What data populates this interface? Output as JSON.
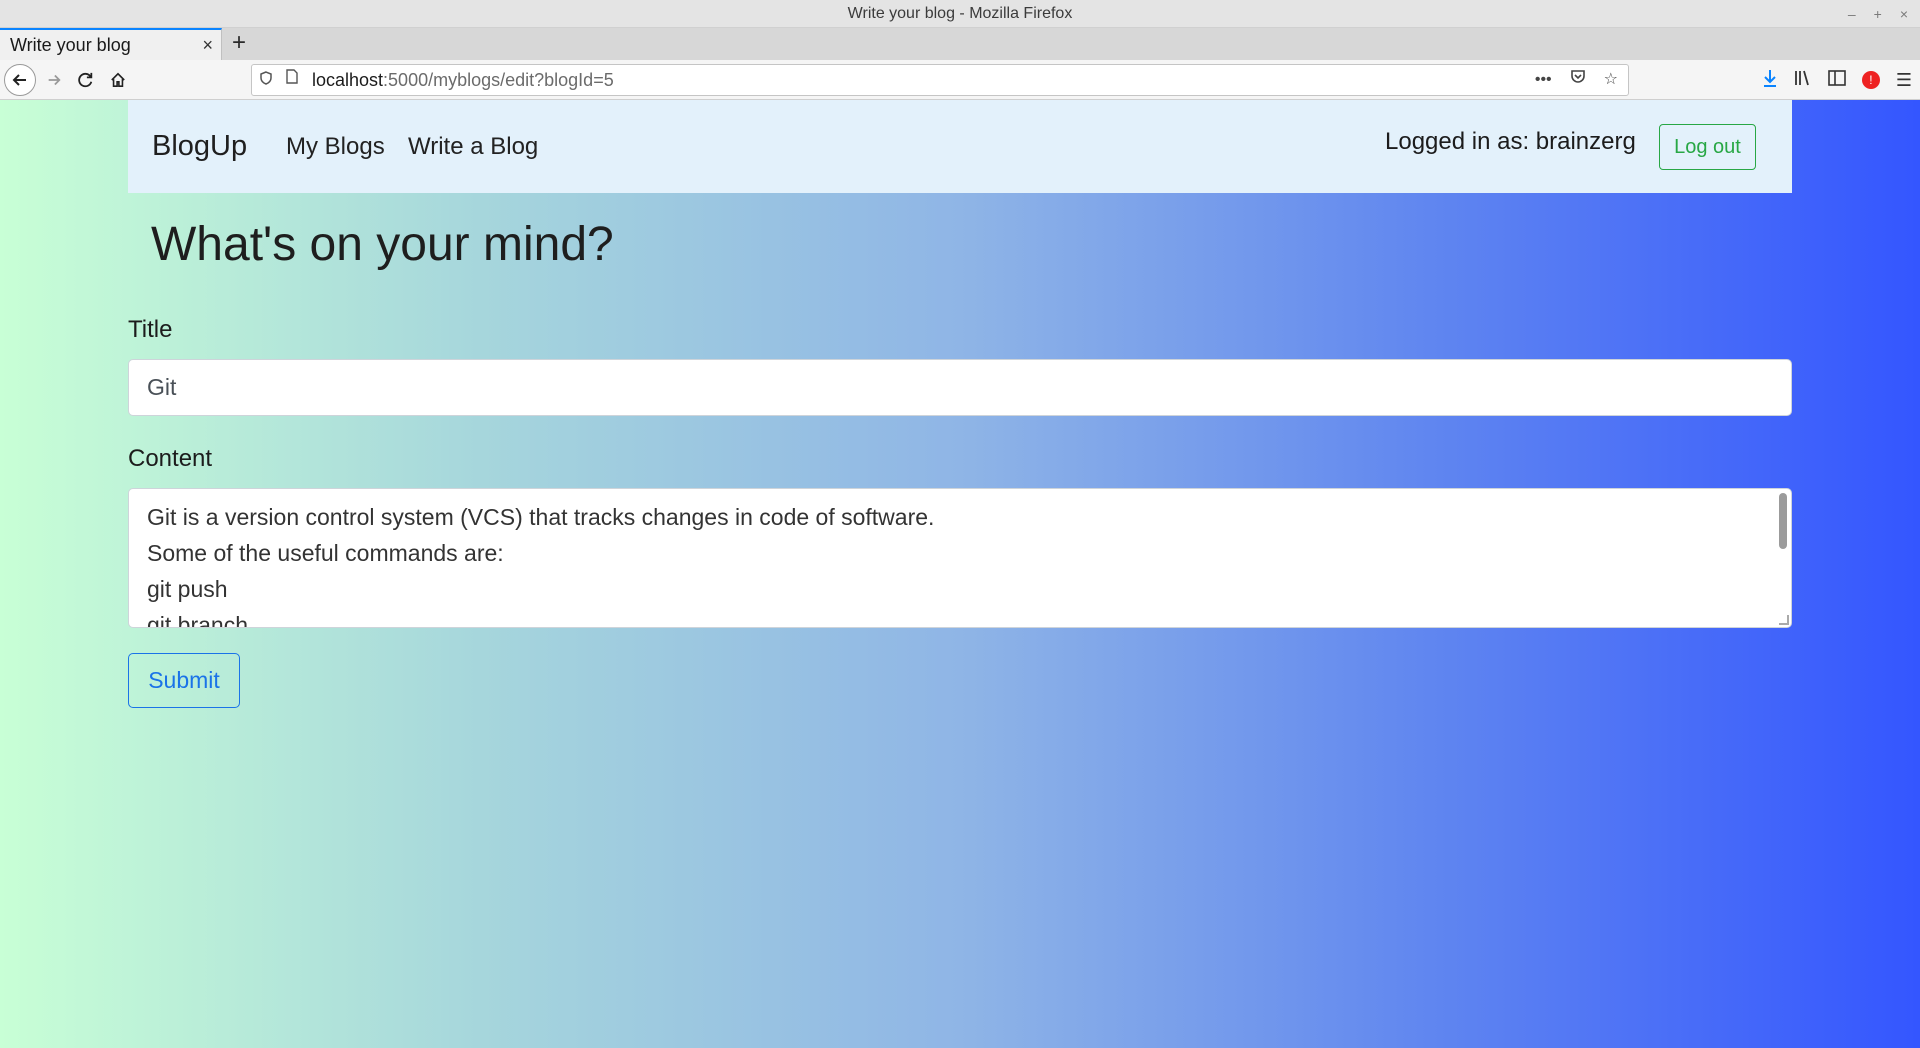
{
  "window": {
    "title": "Write your blog - Mozilla Firefox",
    "controls": [
      "–",
      "+",
      "×"
    ]
  },
  "browser": {
    "tab_title": "Write your blog",
    "tab_close": "×",
    "new_tab": "+",
    "url_host": "localhost",
    "url_rest": ":5000/myblogs/edit?blogId=5",
    "icons": {
      "back": "back-arrow-icon",
      "forward": "forward-arrow-icon",
      "reload": "reload-icon",
      "home": "home-icon",
      "shield": "tracking-shield-icon",
      "page": "page-info-icon",
      "more": "more-actions-icon",
      "pocket": "pocket-icon",
      "bookmark": "bookmark-star-icon",
      "download": "download-icon",
      "library": "library-icon",
      "sidebar": "sidebar-icon",
      "extension": "adblock-icon",
      "menu": "hamburger-menu-icon"
    }
  },
  "site": {
    "brand": "BlogUp",
    "nav": {
      "my_blogs": "My Blogs",
      "write_blog": "Write a Blog"
    },
    "logged_in": "Logged in as: brainzerg",
    "logout": "Log out"
  },
  "form": {
    "heading": "What's on your mind?",
    "title_label": "Title",
    "title_value": "Git",
    "content_label": "Content",
    "content_value": "Git is a version control system (VCS) that tracks changes in code of software.\nSome of the useful commands are:\ngit push\ngit branch",
    "submit": "Submit"
  },
  "colors": {
    "gradient_start": "#c8ffd6",
    "gradient_end": "#3456ff",
    "navbar_bg": "#e3f1fb",
    "logout": "#28a745",
    "submit": "#1a73e8"
  }
}
